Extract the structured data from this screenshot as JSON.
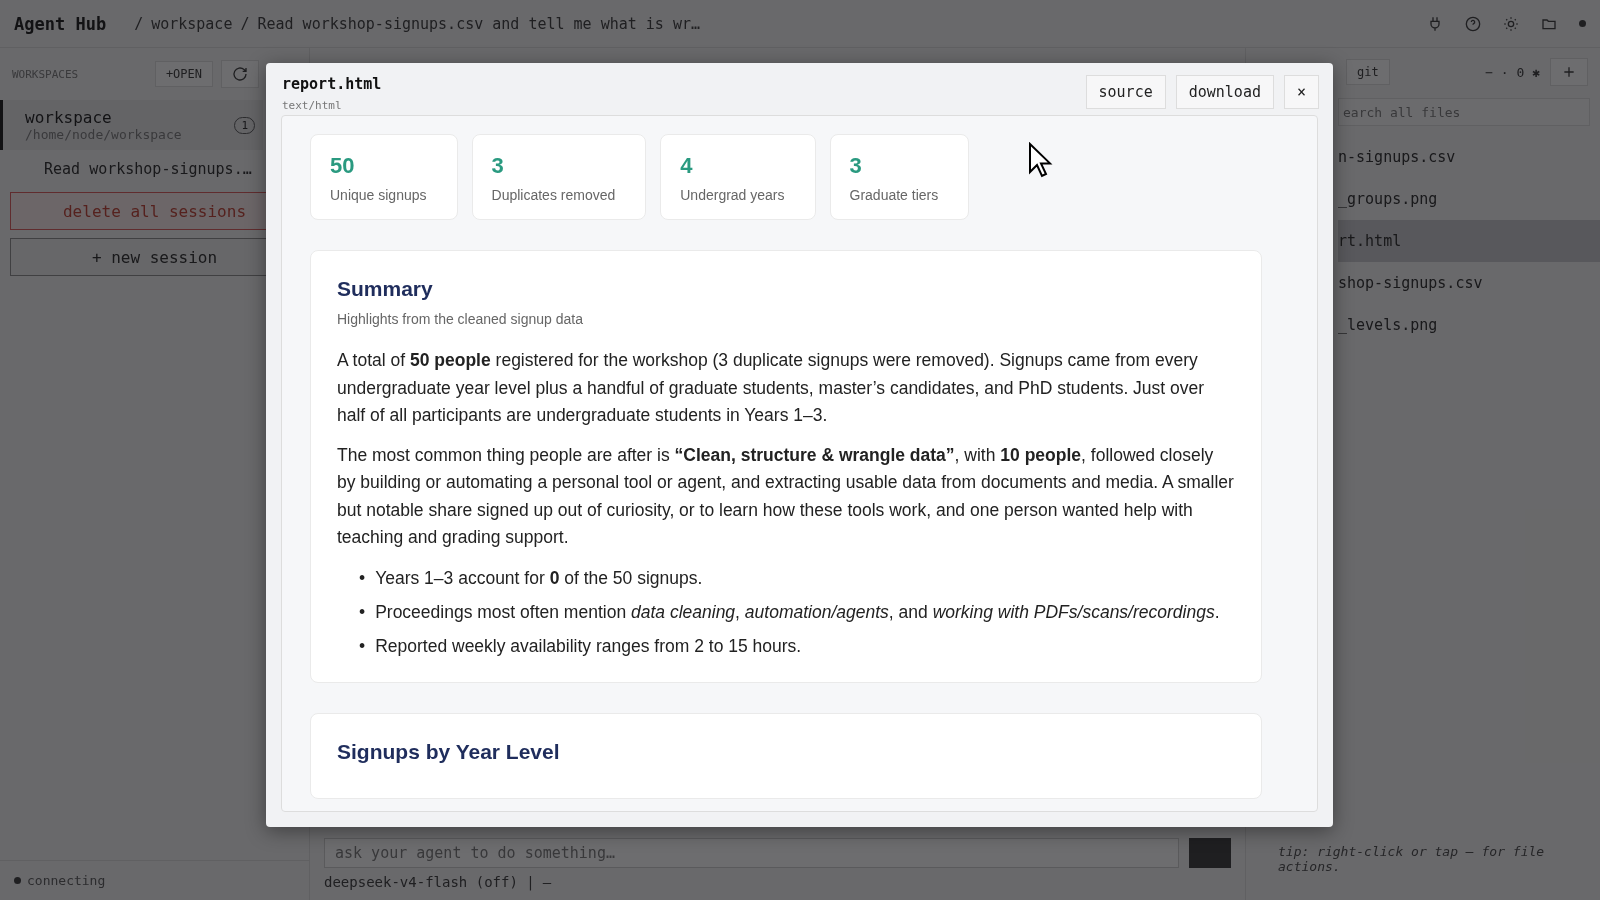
{
  "topbar": {
    "brand": "Agent Hub",
    "breadcrumb": [
      {
        "separator": "/",
        "label": "workspace"
      },
      {
        "separator": "/",
        "label": "Read workshop-signups.csv and tell me what is wr…"
      }
    ]
  },
  "sidebar": {
    "heading": "WORKSPACES",
    "open_button": "+OPEN",
    "workspaces": [
      {
        "name": "workspace",
        "path": "/home/node/workspace",
        "count": "1",
        "selected": true
      }
    ],
    "sessions": [
      {
        "title": "Read workshop-signups.…"
      }
    ],
    "delete_button": "delete all sessions",
    "new_button": "+ new session",
    "status": "connecting"
  },
  "chat": {
    "placeholder": "ask your agent to do something…",
    "model": "deepseek-v4-flash (off) |",
    "branch": "—"
  },
  "files": {
    "git_button": "git",
    "counts": "− · 0 ✱",
    "search": {
      "placeholder": "earch all files"
    },
    "items": [
      {
        "name": "n-signups.csv",
        "selected": false
      },
      {
        "name": "_groups.png",
        "selected": false
      },
      {
        "name": "rt.html",
        "selected": true
      },
      {
        "name": "shop-signups.csv",
        "selected": false
      },
      {
        "name": "_levels.png",
        "selected": false
      }
    ],
    "tip": "tip: right-click or tap — for file actions."
  },
  "modal": {
    "title": "report.html",
    "subtitle": "text/html",
    "buttons": [
      "source",
      "download"
    ],
    "close": "×",
    "stats": [
      {
        "value": "50",
        "label": "Unique signups"
      },
      {
        "value": "3",
        "label": "Duplicates removed"
      },
      {
        "value": "4",
        "label": "Undergrad years"
      },
      {
        "value": "3",
        "label": "Graduate tiers"
      }
    ],
    "summary": {
      "title": "Summary",
      "subtitle": "Highlights from the cleaned signup data",
      "paragraphs": [
        "A total of **50 people** registered for the workshop (3 duplicate signups were removed). Signups came from every undergraduate year level plus a handful of graduate students, master’s candidates, and PhD students. Just over half of all participants are undergraduate students in Years 1–3.",
        "The most common thing people are after is **“Clean, structure & wrangle data”**, with **10 people**, followed closely by building or automating a personal tool or agent, and extracting usable data from documents and media. A smaller but notable share signed up out of curiosity, or to learn how these tools work, and one person wanted help with teaching and grading support."
      ],
      "bullet_marker": "•",
      "bullets": [
        "Years 1–3 account for **0** of the 50 signups.",
        "Proceedings most often mention *data cleaning*, *automation/agents*, and *working with PDFs/scans/recordings*.",
        "Reported weekly availability ranges from 2 to 15 hours."
      ]
    },
    "next_section": {
      "title": "Signups by Year Level"
    }
  }
}
